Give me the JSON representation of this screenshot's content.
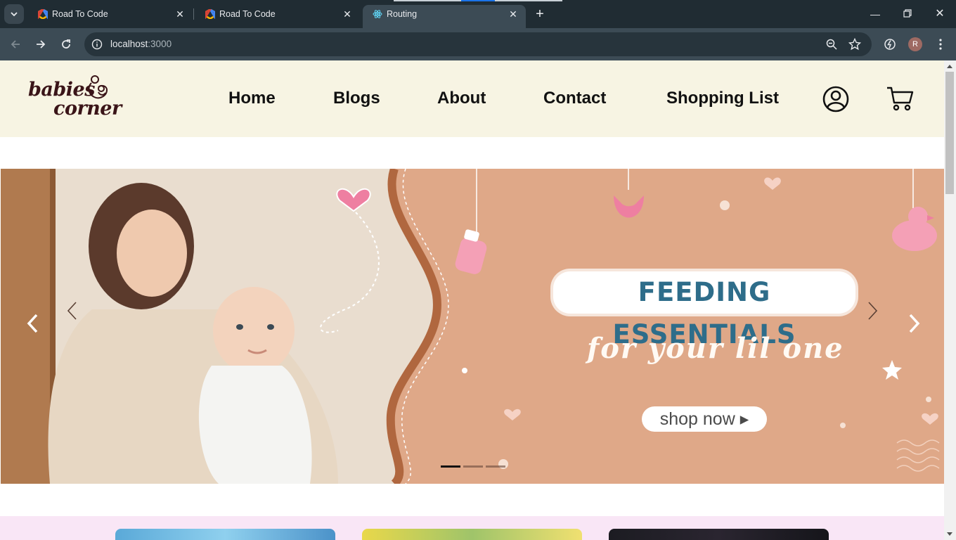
{
  "browser": {
    "tabs": [
      {
        "title": "Road To Code",
        "favicon": "colorful-hexagon-icon",
        "active": false
      },
      {
        "title": "Road To Code",
        "favicon": "colorful-hexagon-icon",
        "active": false
      },
      {
        "title": "Routing",
        "favicon": "react-atom-icon",
        "active": true
      }
    ],
    "new_tab": "+",
    "address": {
      "host": "localhost",
      "port": ":3000"
    },
    "profile_initial": "R"
  },
  "site": {
    "logo": {
      "line1": "babies",
      "line2": "corner"
    },
    "nav": [
      "Home",
      "Blogs",
      "About",
      "Contact",
      "Shopping List"
    ],
    "icons": [
      "user-icon",
      "cart-icon"
    ],
    "colors": {
      "header_bg": "#f7f4e3",
      "banner_bg": "#dfa888",
      "strip_bg": "#f9e6f6"
    }
  },
  "banner": {
    "title": "FEEDING ESSENTIALS",
    "subtitle": "for your lil one",
    "cta": "shop now ▸",
    "slides_total": 3,
    "active_slide": 1
  }
}
